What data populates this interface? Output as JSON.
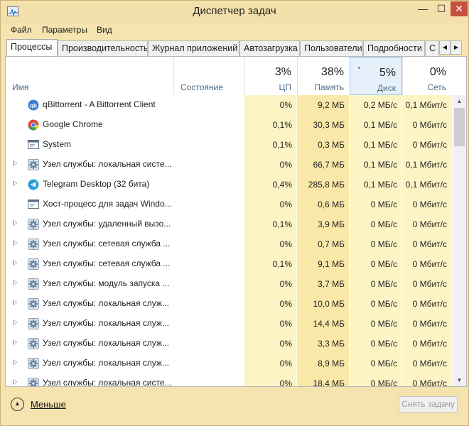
{
  "window": {
    "title": "Диспетчер задач",
    "controls": {
      "minimize": "—",
      "maximize": "☐",
      "close": "✕"
    }
  },
  "menu": [
    "Файл",
    "Параметры",
    "Вид"
  ],
  "tabs": [
    {
      "label": "Процессы",
      "active": true
    },
    {
      "label": "Производительность",
      "active": false
    },
    {
      "label": "Журнал приложений",
      "active": false
    },
    {
      "label": "Автозагрузка",
      "active": false
    },
    {
      "label": "Пользователи",
      "active": false
    },
    {
      "label": "Подробности",
      "active": false
    },
    {
      "label": "С",
      "active": false
    }
  ],
  "columns": {
    "name": "Имя",
    "state": "Состояние",
    "cpu": {
      "pct": "3%",
      "label": "ЦП"
    },
    "memory": {
      "pct": "38%",
      "label": "Память"
    },
    "disk": {
      "pct": "5%",
      "label": "Диск",
      "sorted": true
    },
    "network": {
      "pct": "0%",
      "label": "Сеть"
    }
  },
  "processes": [
    {
      "name": "qBittorrent - A Bittorrent Client",
      "icon": "qbittorrent-icon",
      "expandable": false,
      "cpu": "0%",
      "memory": "9,2 МБ",
      "disk": "0,2 МБ/с",
      "network": "0,1 Мбит/с"
    },
    {
      "name": "Google Chrome",
      "icon": "chrome-icon",
      "expandable": false,
      "cpu": "0,1%",
      "memory": "30,3 МБ",
      "disk": "0,1 МБ/с",
      "network": "0 Мбит/с"
    },
    {
      "name": "System",
      "icon": "system-window-icon",
      "expandable": false,
      "cpu": "0,1%",
      "memory": "0,3 МБ",
      "disk": "0,1 МБ/с",
      "network": "0 Мбит/с"
    },
    {
      "name": "Узел службы: локальная систе...",
      "icon": "service-gear-icon",
      "expandable": true,
      "cpu": "0%",
      "memory": "66,7 МБ",
      "disk": "0,1 МБ/с",
      "network": "0,1 Мбит/с"
    },
    {
      "name": "Telegram Desktop (32 бита)",
      "icon": "telegram-icon",
      "expandable": true,
      "cpu": "0,4%",
      "memory": "285,8 МБ",
      "disk": "0,1 МБ/с",
      "network": "0,1 Мбит/с"
    },
    {
      "name": "Хост-процесс для задач Windo...",
      "icon": "system-window-icon",
      "expandable": false,
      "cpu": "0%",
      "memory": "0,6 МБ",
      "disk": "0 МБ/с",
      "network": "0 Мбит/с"
    },
    {
      "name": "Узел службы: удаленный вызо...",
      "icon": "service-gear-icon",
      "expandable": true,
      "cpu": "0,1%",
      "memory": "3,9 МБ",
      "disk": "0 МБ/с",
      "network": "0 Мбит/с"
    },
    {
      "name": "Узел службы: сетевая служба ...",
      "icon": "service-gear-icon",
      "expandable": true,
      "cpu": "0%",
      "memory": "0,7 МБ",
      "disk": "0 МБ/с",
      "network": "0 Мбит/с"
    },
    {
      "name": "Узел службы: сетевая служба ...",
      "icon": "service-gear-icon",
      "expandable": true,
      "cpu": "0,1%",
      "memory": "9,1 МБ",
      "disk": "0 МБ/с",
      "network": "0 Мбит/с"
    },
    {
      "name": "Узел службы: модуль запуска ...",
      "icon": "service-gear-icon",
      "expandable": true,
      "cpu": "0%",
      "memory": "3,7 МБ",
      "disk": "0 МБ/с",
      "network": "0 Мбит/с"
    },
    {
      "name": "Узел службы: локальная служ...",
      "icon": "service-gear-icon",
      "expandable": true,
      "cpu": "0%",
      "memory": "10,0 МБ",
      "disk": "0 МБ/с",
      "network": "0 Мбит/с"
    },
    {
      "name": "Узел службы: локальная служ...",
      "icon": "service-gear-icon",
      "expandable": true,
      "cpu": "0%",
      "memory": "14,4 МБ",
      "disk": "0 МБ/с",
      "network": "0 Мбит/с"
    },
    {
      "name": "Узел службы: локальная служ...",
      "icon": "service-gear-icon",
      "expandable": true,
      "cpu": "0%",
      "memory": "3,3 МБ",
      "disk": "0 МБ/с",
      "network": "0 Мбит/с"
    },
    {
      "name": "Узел службы: локальная служ...",
      "icon": "service-gear-icon",
      "expandable": true,
      "cpu": "0%",
      "memory": "8,9 МБ",
      "disk": "0 МБ/с",
      "network": "0 Мбит/с"
    },
    {
      "name": "Узел службы: локальная систе...",
      "icon": "service-gear-icon",
      "expandable": true,
      "cpu": "0%",
      "memory": "18,4 МБ",
      "disk": "0 МБ/с",
      "network": "0 Мбит/с"
    }
  ],
  "footer": {
    "fewer_details": "Меньше",
    "end_task": "Снять задачу"
  },
  "colors": {
    "window_frame": "#f5e3b0",
    "heat_light": "#fdf4c5",
    "heat_memory": "#f9e8a8",
    "sorted_header": "#e6f0fa",
    "close_button": "#c7503f"
  }
}
